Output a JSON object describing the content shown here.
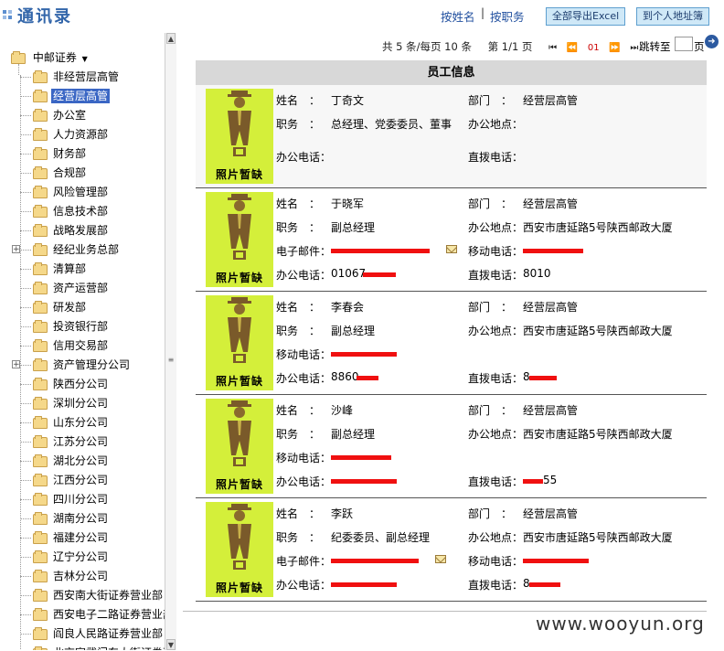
{
  "header": {
    "title": "通讯录",
    "link_by_name": "按姓名",
    "separator": "|",
    "link_by_position": "按职务",
    "btn_export": "全部导出Excel",
    "btn_personal": "到个人地址簿"
  },
  "tree": {
    "root": "中邮证券",
    "items": [
      {
        "label": "非经营层高管",
        "expandable": false,
        "selected": false
      },
      {
        "label": "经营层高管",
        "expandable": false,
        "selected": true
      },
      {
        "label": "办公室",
        "expandable": false,
        "selected": false
      },
      {
        "label": "人力资源部",
        "expandable": false,
        "selected": false
      },
      {
        "label": "财务部",
        "expandable": false,
        "selected": false
      },
      {
        "label": "合规部",
        "expandable": false,
        "selected": false
      },
      {
        "label": "风险管理部",
        "expandable": false,
        "selected": false
      },
      {
        "label": "信息技术部",
        "expandable": false,
        "selected": false
      },
      {
        "label": "战略发展部",
        "expandable": false,
        "selected": false
      },
      {
        "label": "经纪业务总部",
        "expandable": true,
        "selected": false
      },
      {
        "label": "清算部",
        "expandable": false,
        "selected": false
      },
      {
        "label": "资产运营部",
        "expandable": false,
        "selected": false
      },
      {
        "label": "研发部",
        "expandable": false,
        "selected": false
      },
      {
        "label": "投资银行部",
        "expandable": false,
        "selected": false
      },
      {
        "label": "信用交易部",
        "expandable": false,
        "selected": false
      },
      {
        "label": "资产管理分公司",
        "expandable": true,
        "selected": false
      },
      {
        "label": "陕西分公司",
        "expandable": false,
        "selected": false
      },
      {
        "label": "深圳分公司",
        "expandable": false,
        "selected": false
      },
      {
        "label": "山东分公司",
        "expandable": false,
        "selected": false
      },
      {
        "label": "江苏分公司",
        "expandable": false,
        "selected": false
      },
      {
        "label": "湖北分公司",
        "expandable": false,
        "selected": false
      },
      {
        "label": "江西分公司",
        "expandable": false,
        "selected": false
      },
      {
        "label": "四川分公司",
        "expandable": false,
        "selected": false
      },
      {
        "label": "湖南分公司",
        "expandable": false,
        "selected": false
      },
      {
        "label": "福建分公司",
        "expandable": false,
        "selected": false
      },
      {
        "label": "辽宁分公司",
        "expandable": false,
        "selected": false
      },
      {
        "label": "吉林分公司",
        "expandable": false,
        "selected": false
      },
      {
        "label": "西安南大街证券营业部",
        "expandable": false,
        "selected": false
      },
      {
        "label": "西安电子二路证券营业部",
        "expandable": false,
        "selected": false
      },
      {
        "label": "阎良人民路证券营业部",
        "expandable": false,
        "selected": false
      },
      {
        "label": "北京宣武门东大街证券营",
        "expandable": false,
        "selected": false
      }
    ]
  },
  "pager": {
    "summary": "共 5 条/每页 10 条",
    "page_info": "第 1/1 页",
    "current_page": "01",
    "jump_label": "跳转至",
    "jump_suffix": "页"
  },
  "panel": {
    "title": "员工信息",
    "photo_caption": "照片暂缺",
    "labels": {
      "name": "姓名　：",
      "dept": "部门　：",
      "position": "职务　：",
      "office": "办公地点：",
      "office_phone": "办公电话：",
      "direct_phone": "直拨电话：",
      "email": "电子邮件：",
      "mobile": "移动电话："
    }
  },
  "employees": [
    {
      "name": "丁奇文",
      "dept": "经营层高管",
      "position": "总经理、党委委员、董事",
      "office": "",
      "office_phone": "",
      "direct_phone": ""
    },
    {
      "name": "于晓军",
      "dept": "经营层高管",
      "position": "副总经理",
      "office": "西安市唐延路5号陕西邮政大厦",
      "office_phone": "01067",
      "direct_phone": "8010"
    },
    {
      "name": "李春会",
      "dept": "经营层高管",
      "position": "副总经理",
      "office": "西安市唐延路5号陕西邮政大厦",
      "office_phone": "8860",
      "direct_phone": "8"
    },
    {
      "name": "沙峰",
      "dept": "经营层高管",
      "position": "副总经理",
      "office": "西安市唐延路5号陕西邮政大厦",
      "office_phone": "",
      "direct_phone": "55"
    },
    {
      "name": "李跃",
      "dept": "经营层高管",
      "position": "纪委委员、副总经理",
      "office": "西安市唐延路5号陕西邮政大厦",
      "office_phone": "",
      "direct_phone": "8"
    }
  ],
  "watermark": "www.wooyun.org",
  "colors": {
    "accent": "#3366aa",
    "photo_bg": "#d4ef3a",
    "redaction": "#f01010",
    "selected": "#3a66c4"
  }
}
